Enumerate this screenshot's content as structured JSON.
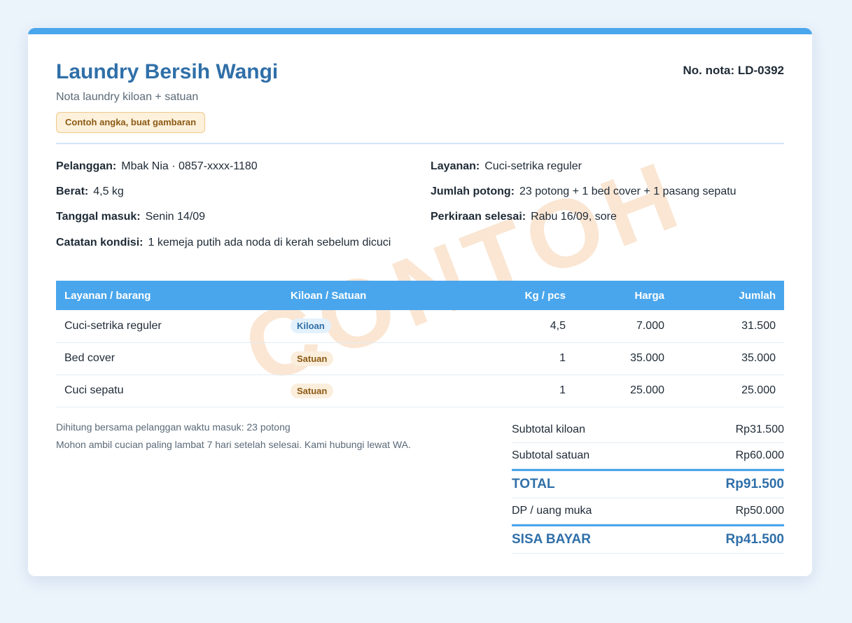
{
  "header": {
    "shop_name": "Laundry Bersih Wangi",
    "subtitle": "Nota laundry kiloan + satuan",
    "example_badge": "Contoh angka, buat gambaran",
    "nota_number": "No. nota: LD-0392"
  },
  "watermark": "CONTOH",
  "info": {
    "customer_label": "Pelanggan:",
    "customer_value": "Mbak Nia · 0857-xxxx-1180",
    "weight_label": "Berat:",
    "weight_value": "4,5 kg",
    "date_in_label": "Tanggal masuk:",
    "date_in_value": "Senin 14/09",
    "condition_label": "Catatan kondisi:",
    "condition_value": "1 kemeja putih ada noda di kerah sebelum dicuci",
    "service_label": "Layanan:",
    "service_value": "Cuci-setrika reguler",
    "pieces_label": "Jumlah potong:",
    "pieces_value": "23 potong + 1 bed cover + 1 pasang sepatu",
    "eta_label": "Perkiraan selesai:",
    "eta_value": "Rabu 16/09, sore"
  },
  "table": {
    "headers": [
      "Layanan / barang",
      "Kiloan / Satuan",
      "Kg / pcs",
      "Harga",
      "Jumlah"
    ],
    "rows": [
      {
        "item": "Cuci-setrika reguler",
        "type": "Kiloan",
        "qty": "4,5",
        "price": "7.000",
        "amount": "31.500"
      },
      {
        "item": "Bed cover",
        "type": "Satuan",
        "qty": "1",
        "price": "35.000",
        "amount": "35.000"
      },
      {
        "item": "Cuci sepatu",
        "type": "Satuan",
        "qty": "1",
        "price": "25.000",
        "amount": "25.000"
      }
    ]
  },
  "notes": {
    "line1": "Dihitung bersama pelanggan waktu masuk: 23 potong",
    "line2": "Mohon ambil cucian paling lambat 7 hari setelah selesai. Kami hubungi lewat WA."
  },
  "totals": {
    "subtotal_kiloan_label": "Subtotal kiloan",
    "subtotal_kiloan_value": "Rp31.500",
    "subtotal_satuan_label": "Subtotal satuan",
    "subtotal_satuan_value": "Rp60.000",
    "total_label": "TOTAL",
    "total_value": "Rp91.500",
    "dp_label": "DP / uang muka",
    "dp_value": "Rp50.000",
    "remaining_label": "SISA BAYAR",
    "remaining_value": "Rp41.500"
  },
  "colors": {
    "accent": "#4aa6ec",
    "brand": "#2f6fa8",
    "badge_bg": "#fdf1dc",
    "watermark": "#f7d2b0"
  }
}
